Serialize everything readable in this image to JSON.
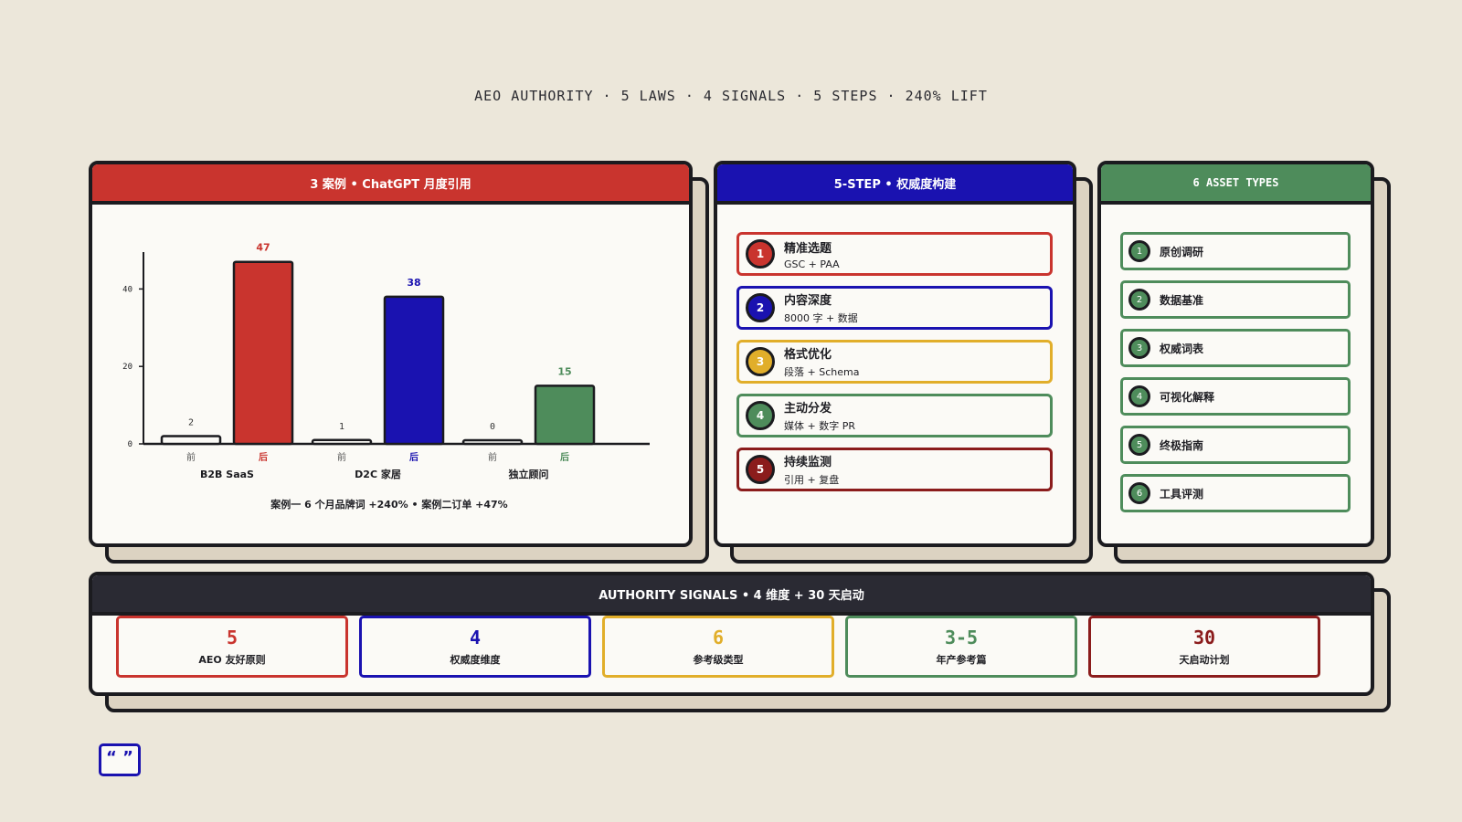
{
  "headline": "AEO AUTHORITY · 5 LAWS · 4 SIGNALS · 5 STEPS · 240% LIFT",
  "cases_panel": {
    "title": "3 案例 • ChatGPT 月度引用",
    "caption": "案例一 6 个月品牌词 +240% • 案例二订单 +47%"
  },
  "chart_data": {
    "type": "bar",
    "categories": [
      "B2B SaaS",
      "D2C 家居",
      "独立顾问"
    ],
    "series": [
      {
        "name": "前",
        "values": [
          2,
          1,
          0
        ]
      },
      {
        "name": "后",
        "values": [
          47,
          38,
          15
        ]
      }
    ],
    "yticks": [
      0,
      20,
      40
    ],
    "ylim": [
      0,
      50
    ],
    "colors": {
      "before": "#FBFAF6",
      "after": [
        "#C9342E",
        "#1A12B0",
        "#4E8C5B"
      ]
    }
  },
  "steps_panel": {
    "title": "5-STEP • 权威度构建",
    "steps": [
      {
        "n": "1",
        "title": "精准选题",
        "sub": "GSC + PAA",
        "color": "#C9342E"
      },
      {
        "n": "2",
        "title": "内容深度",
        "sub": "8000 字 + 数据",
        "color": "#1A12B0"
      },
      {
        "n": "3",
        "title": "格式优化",
        "sub": "段落 + Schema",
        "color": "#E1AE2A"
      },
      {
        "n": "4",
        "title": "主动分发",
        "sub": "媒体 + 数字 PR",
        "color": "#4E8C5B"
      },
      {
        "n": "5",
        "title": "持续监测",
        "sub": "引用 + 复盘",
        "color": "#8B1C1C"
      }
    ]
  },
  "assets_panel": {
    "title": "6 ASSET TYPES",
    "items": [
      {
        "n": "1",
        "label": "原创调研"
      },
      {
        "n": "2",
        "label": "数据基准"
      },
      {
        "n": "3",
        "label": "权威词表"
      },
      {
        "n": "4",
        "label": "可视化解释"
      },
      {
        "n": "5",
        "label": "终极指南"
      },
      {
        "n": "6",
        "label": "工具评测"
      }
    ]
  },
  "signals_panel": {
    "title": "AUTHORITY SIGNALS • 4 维度 + 30 天启动",
    "items": [
      {
        "value": "5",
        "label": "AEO 友好原则",
        "color": "#C9342E"
      },
      {
        "value": "4",
        "label": "权威度维度",
        "color": "#1A12B0"
      },
      {
        "value": "6",
        "label": "参考级类型",
        "color": "#E1AE2A"
      },
      {
        "value": "3-5",
        "label": "年产参考篇",
        "color": "#4E8C5B"
      },
      {
        "value": "30",
        "label": "天启动计划",
        "color": "#8B1C1C"
      }
    ]
  },
  "quote_icon": "quote-icon",
  "quote_glyph": "“ ”"
}
